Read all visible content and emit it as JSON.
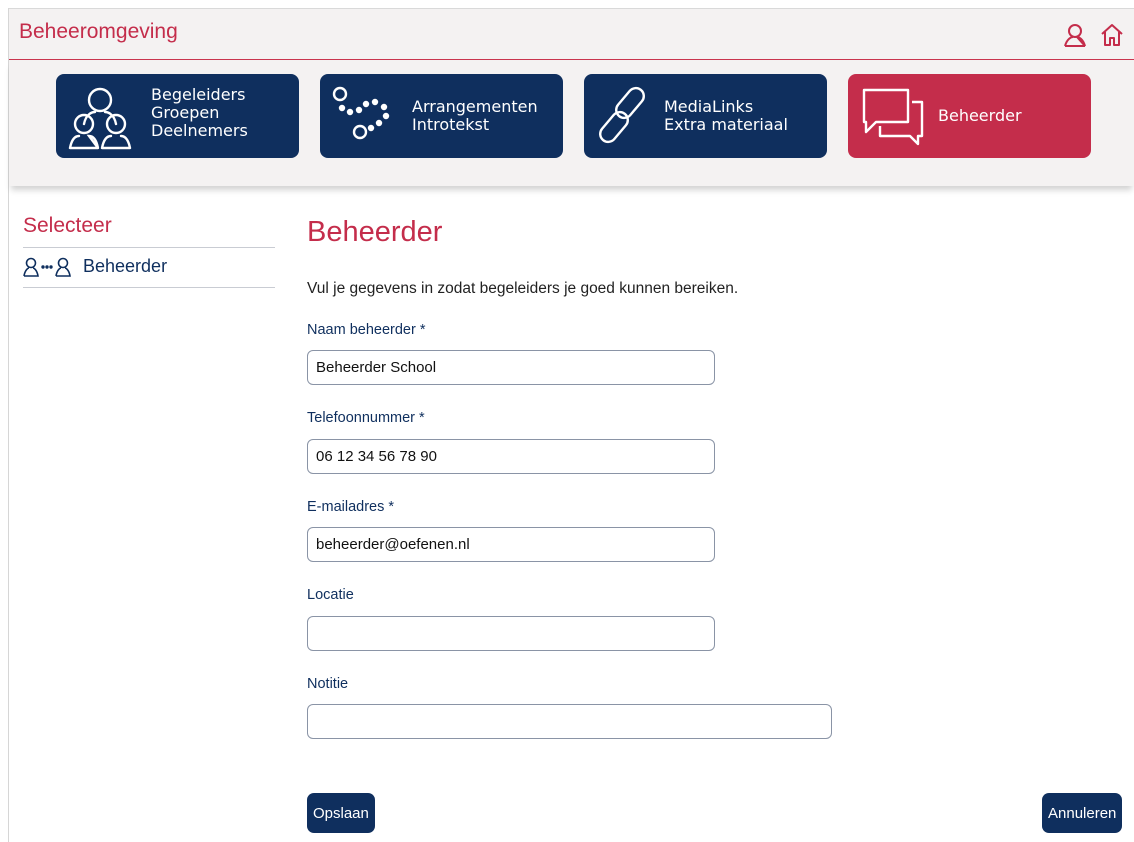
{
  "header": {
    "title": "Beheeromgeving",
    "icons": [
      "user-icon",
      "home-icon"
    ]
  },
  "tiles": [
    {
      "icon": "people-icon",
      "lines": [
        "Begeleiders",
        "Groepen",
        "Deelnemers"
      ]
    },
    {
      "icon": "path-dots-icon",
      "lines": [
        "Arrangementen",
        "Introtekst"
      ]
    },
    {
      "icon": "link-icon",
      "lines": [
        "MediaLinks",
        "Extra materiaal"
      ]
    },
    {
      "icon": "chat-bubbles-icon",
      "lines": [
        "Beheerder"
      ],
      "active": true
    }
  ],
  "sidebar": {
    "title": "Selecteer",
    "items": [
      {
        "label": "Beheerder",
        "icon": "user-link-user-icon"
      }
    ]
  },
  "main": {
    "title": "Beheerder",
    "intro": "Vul je gegevens in zodat begeleiders je goed kunnen bereiken.",
    "fields": {
      "name": {
        "label": "Naam beheerder *",
        "value": "Beheerder School"
      },
      "phone": {
        "label": "Telefoonnummer *",
        "value": "06 12 34 56 78 90"
      },
      "email": {
        "label": "E-mailadres *",
        "value": "beheerder@oefenen.nl"
      },
      "location": {
        "label": "Locatie",
        "value": ""
      },
      "note": {
        "label": "Notitie",
        "value": ""
      }
    }
  },
  "buttons": {
    "save": "Opslaan",
    "cancel": "Annuleren"
  },
  "colors": {
    "brand_red": "#c42d4b",
    "navy": "#0f2f5e",
    "bar_bg": "#f4f2f2"
  }
}
